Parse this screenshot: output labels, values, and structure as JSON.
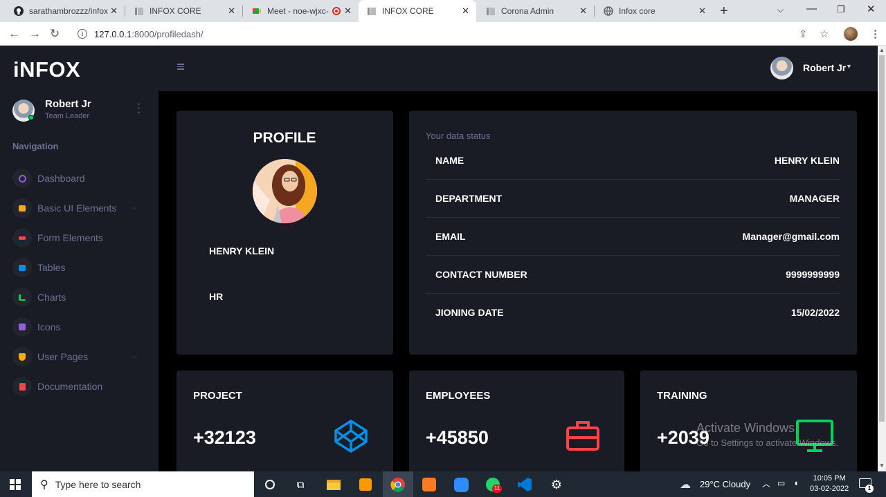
{
  "browser": {
    "tabs": [
      {
        "title": "sarathambrozzz/infox",
        "icon": "github-icon"
      },
      {
        "title": "INFOX CORE",
        "icon": "page-icon"
      },
      {
        "title": "Meet - noe-wjxc-",
        "icon": "meet-icon"
      },
      {
        "title": "INFOX CORE",
        "icon": "page-icon",
        "active": true
      },
      {
        "title": "Corona Admin",
        "icon": "page-icon"
      },
      {
        "title": "Infox core",
        "icon": "globe-icon"
      }
    ],
    "url_host": "127.0.0.1",
    "url_path": ":8000/profiledash/"
  },
  "sidebar": {
    "brand": "iNFOX",
    "user_name": "Robert Jr",
    "user_role": "Team Leader",
    "nav_caption": "Navigation",
    "items": [
      {
        "label": "Dashboard",
        "icon": "speedometer-icon",
        "color": "#8f5fe8"
      },
      {
        "label": "Basic UI Elements",
        "icon": "laptop-icon",
        "color": "#ffab00"
      },
      {
        "label": "Form Elements",
        "icon": "playlist-icon",
        "color": "#fc424a"
      },
      {
        "label": "Tables",
        "icon": "table-icon",
        "color": "#0090e7"
      },
      {
        "label": "Charts",
        "icon": "chart-bar-icon",
        "color": "#00d25b"
      },
      {
        "label": "Icons",
        "icon": "contacts-icon",
        "color": "#8f5fe8"
      },
      {
        "label": "User Pages",
        "icon": "security-icon",
        "color": "#ffab00"
      },
      {
        "label": "Documentation",
        "icon": "file-document-icon",
        "color": "#fc424a"
      }
    ]
  },
  "topbar": {
    "user_name": "Robert Jr"
  },
  "profile": {
    "title": "PROFILE",
    "name": "HENRY KLEIN",
    "department": "HR"
  },
  "data_status": {
    "caption": "Your data status",
    "rows": [
      {
        "key": "NAME",
        "value": "HENRY KLEIN"
      },
      {
        "key": "DEPARTMENT",
        "value": "MANAGER"
      },
      {
        "key": "EMAIL",
        "value": "Manager@gmail.com"
      },
      {
        "key": "CONTACT NUMBER",
        "value": "9999999999"
      },
      {
        "key": "JIONING DATE",
        "value": "15/02/2022"
      }
    ]
  },
  "stats": [
    {
      "label": "PROJECT",
      "value": "+32123",
      "icon": "codepen-icon",
      "color": "#0090e7"
    },
    {
      "label": "EMPLOYEES",
      "value": "+45850",
      "icon": "briefcase-icon",
      "color": "#fc424a"
    },
    {
      "label": "TRAINING",
      "value": "+2039",
      "icon": "monitor-icon",
      "color": "#00d25b"
    }
  ],
  "watermark": {
    "line1": "Activate Windows",
    "line2": "Go to Settings to activate Windows."
  },
  "taskbar": {
    "search_placeholder": "Type here to search",
    "weather": "29°C  Cloudy",
    "time": "10:05 PM",
    "date": "03-02-2022",
    "notification_count": "1",
    "whatsapp_badge": "11"
  }
}
